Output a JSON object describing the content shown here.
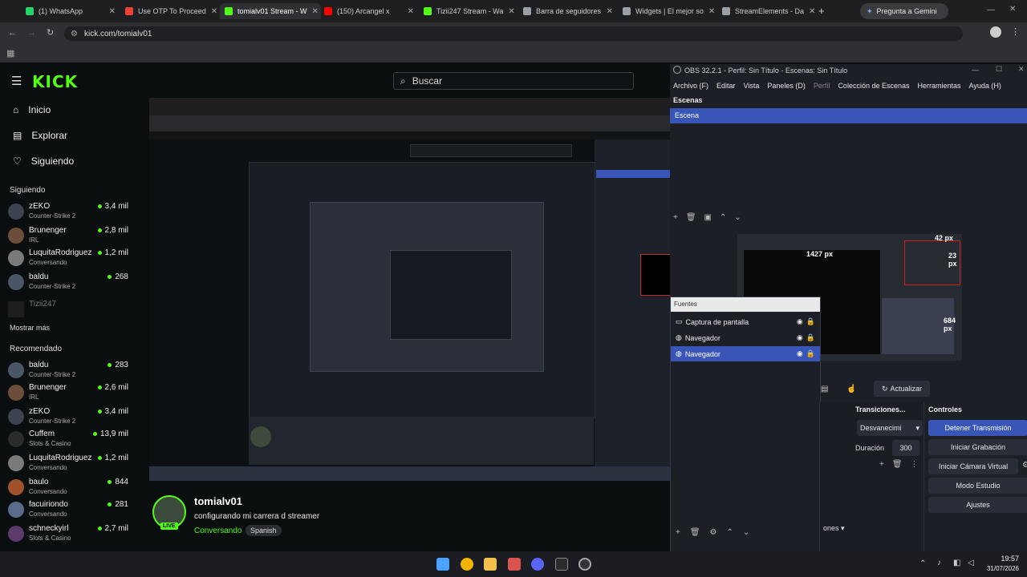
{
  "browser": {
    "tabs": [
      {
        "label": "(1) WhatsApp",
        "color": "#25d366"
      },
      {
        "label": "Use OTP To Proceed",
        "color": "#ea4335"
      },
      {
        "label": "tomialv01 Stream - W",
        "color": "#53fc18"
      },
      {
        "label": "(150) Arcangel x",
        "color": "#ff0000"
      },
      {
        "label": "Tizii247 Stream - Wa",
        "color": "#53fc18"
      },
      {
        "label": "Barra de seguidores",
        "color": "#9aa0a6"
      },
      {
        "label": "Widgets | El mejor so",
        "color": "#9aa0a6"
      },
      {
        "label": "StreamElements - Da",
        "color": "#9aa0a6"
      }
    ],
    "gemini": "Pregunta a Gemini",
    "url": "kick.com/tomialv01"
  },
  "kick": {
    "logo": "KICK",
    "search_placeholder": "Buscar",
    "nav": {
      "home": "Inicio",
      "explore": "Explorar",
      "following": "Siguiendo"
    },
    "following_title": "Siguiendo",
    "following": [
      {
        "name": "zEKO",
        "cat": "Counter-Strike 2",
        "viewers": "3,4 mil"
      },
      {
        "name": "Brunenger",
        "cat": "IRL",
        "viewers": "2,8 mil"
      },
      {
        "name": "LuquitaRodriguez",
        "cat": "Conversando",
        "viewers": "1,2 mil"
      },
      {
        "name": "baldu",
        "cat": "Counter-Strike 2",
        "viewers": "268"
      }
    ],
    "offline": {
      "name": "Tizii247"
    },
    "show_more": "Mostrar más",
    "recommended_title": "Recomendado",
    "recommended": [
      {
        "name": "baldu",
        "cat": "Counter-Strike 2",
        "viewers": "283"
      },
      {
        "name": "Brunenger",
        "cat": "IRL",
        "viewers": "2,6 mil"
      },
      {
        "name": "zEKO",
        "cat": "Counter-Strike 2",
        "viewers": "3,4 mil"
      },
      {
        "name": "Cuffem",
        "cat": "Slots & Casino",
        "viewers": "13,9 mil"
      },
      {
        "name": "LuquitaRodriguez",
        "cat": "Conversando",
        "viewers": "1,2 mil"
      },
      {
        "name": "baulo",
        "cat": "Conversando",
        "viewers": "844"
      },
      {
        "name": "facuiriondo",
        "cat": "Conversando",
        "viewers": "281"
      },
      {
        "name": "schneckyirl",
        "cat": "Slots & Casino",
        "viewers": "2,7 mil"
      }
    ],
    "streamer": {
      "name": "tomialv01",
      "title": "configurando mi carrera d streamer",
      "category": "Conversando",
      "language": "Spanish",
      "live": "LIVE"
    }
  },
  "obs": {
    "title": "OBS 32.2.1 - Perfil: Sin Título - Escenas: Sin Título",
    "menu": [
      "Archivo (F)",
      "Editar",
      "Vista",
      "Paneles (D)",
      "Perfil",
      "Colección de Escenas",
      "Herramientas",
      "Ayuda (H)"
    ],
    "scenes_title": "Escenas",
    "scene": "Escena",
    "overlay": {
      "w": "1427 px",
      "top": "42 px",
      "right": "23 px",
      "bottom": "684 px"
    },
    "sources_title": "Fuentes",
    "sources": [
      "Captura de pantalla",
      "Navegador",
      "Navegador"
    ],
    "refresh": "Actualizar",
    "transitions_title": "Transiciones...",
    "transition": "Desvanecimi",
    "duration_label": "Duración",
    "duration": "300",
    "controls_title": "Controles",
    "controls": [
      "Detener Transmisión",
      "Iniciar Grabación",
      "Iniciar Cámara Virtual",
      "Modo Estudio",
      "Ajustes"
    ],
    "scenes_footer": "ones"
  },
  "taskbar": {
    "time": "19:57",
    "date": "31/07/2026"
  }
}
